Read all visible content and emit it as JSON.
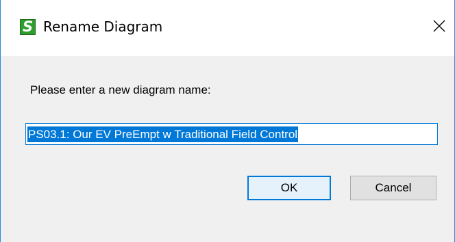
{
  "window": {
    "title": "Rename Diagram",
    "app_icon_letter": "S"
  },
  "dialog": {
    "prompt": "Please enter a new diagram name:",
    "name_value": "PS03.1: Our EV PreEmpt w Traditional Field Control"
  },
  "buttons": {
    "ok_label": "OK",
    "cancel_label": "Cancel"
  },
  "icons": {
    "close": "close-icon",
    "app": "app-icon"
  },
  "colors": {
    "accent": "#0078d7",
    "app_icon": "#2f9e2f",
    "window_border": "#1e8fd5",
    "dialog_bg": "#f0f0f0"
  }
}
